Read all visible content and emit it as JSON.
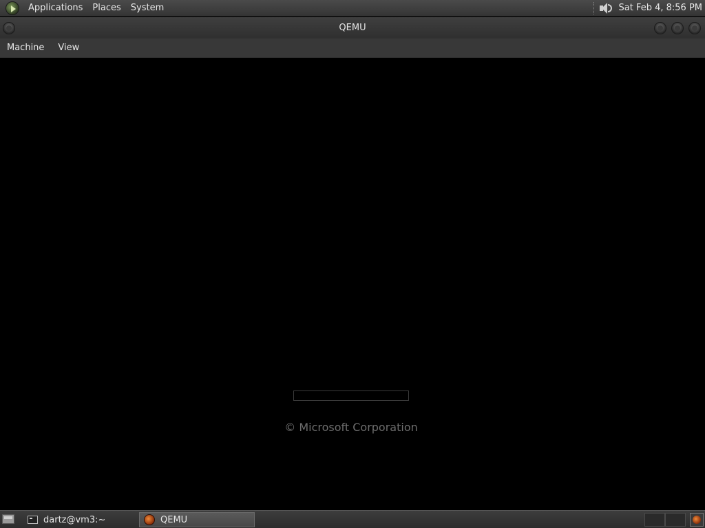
{
  "top_panel": {
    "menus": [
      "Applications",
      "Places",
      "System"
    ],
    "icons": {
      "logo": "gnome-foot-icon",
      "volume": "volume-icon"
    },
    "clock": "Sat Feb  4,  8:56 PM"
  },
  "window": {
    "title": "QEMU",
    "menubar": [
      "Machine",
      "View"
    ]
  },
  "guest": {
    "copyright": "© Microsoft Corporation",
    "boot_progress": 0
  },
  "taskbar": {
    "tasks": [
      {
        "label": "dartz@vm3:~",
        "icon": "terminal-icon",
        "active": false
      },
      {
        "label": "QEMU",
        "icon": "qemu-icon",
        "active": true
      }
    ]
  },
  "colors": {
    "panel": "#3d3d3d",
    "guest_background": "#000000",
    "copyright_text": "#6e6e6e",
    "active_task": "#5a5a5a"
  }
}
